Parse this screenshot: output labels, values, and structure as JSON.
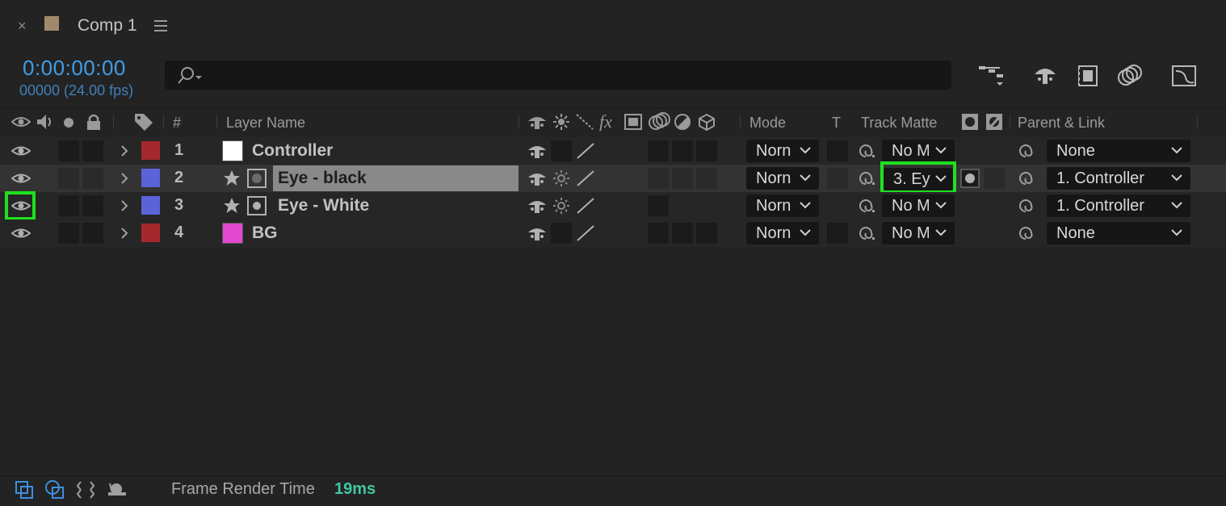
{
  "tab": {
    "close": "×",
    "title": "Comp 1",
    "swatch_color": "#a08a6b"
  },
  "time": {
    "timecode": "0:00:00:00",
    "frames_fps": "00000 (24.00 fps)"
  },
  "search": {
    "placeholder": ""
  },
  "columns": {
    "number": "#",
    "layer_name": "Layer Name",
    "mode": "Mode",
    "t": "T",
    "track_matte": "Track Matte",
    "parent_link": "Parent & Link"
  },
  "layers": [
    {
      "num": "1",
      "name": "Controller",
      "label_color": "#a5282d",
      "icon": "solid-white",
      "mode": "Norn",
      "matte": "No M",
      "parent": "None"
    },
    {
      "num": "2",
      "name": "Eye - black",
      "label_color": "#5a63d8",
      "icon": "shape-layer",
      "mode": "Norn",
      "matte": "3. Ey",
      "parent": "1. Controller"
    },
    {
      "num": "3",
      "name": "Eye - White",
      "label_color": "#5a63d8",
      "icon": "shape-layer",
      "mode": "Norn",
      "matte": "No M",
      "parent": "1. Controller"
    },
    {
      "num": "4",
      "name": "BG",
      "label_color": "#a5282d",
      "icon": "solid-magenta",
      "mode": "Norn",
      "matte": "No M",
      "parent": "None"
    }
  ],
  "footer": {
    "label": "Frame Render Time",
    "value": "19ms"
  },
  "colors": {
    "accent_blue": "#3f9ee9",
    "highlight_green": "#1fe01f",
    "render_time": "#3fc8a2"
  }
}
